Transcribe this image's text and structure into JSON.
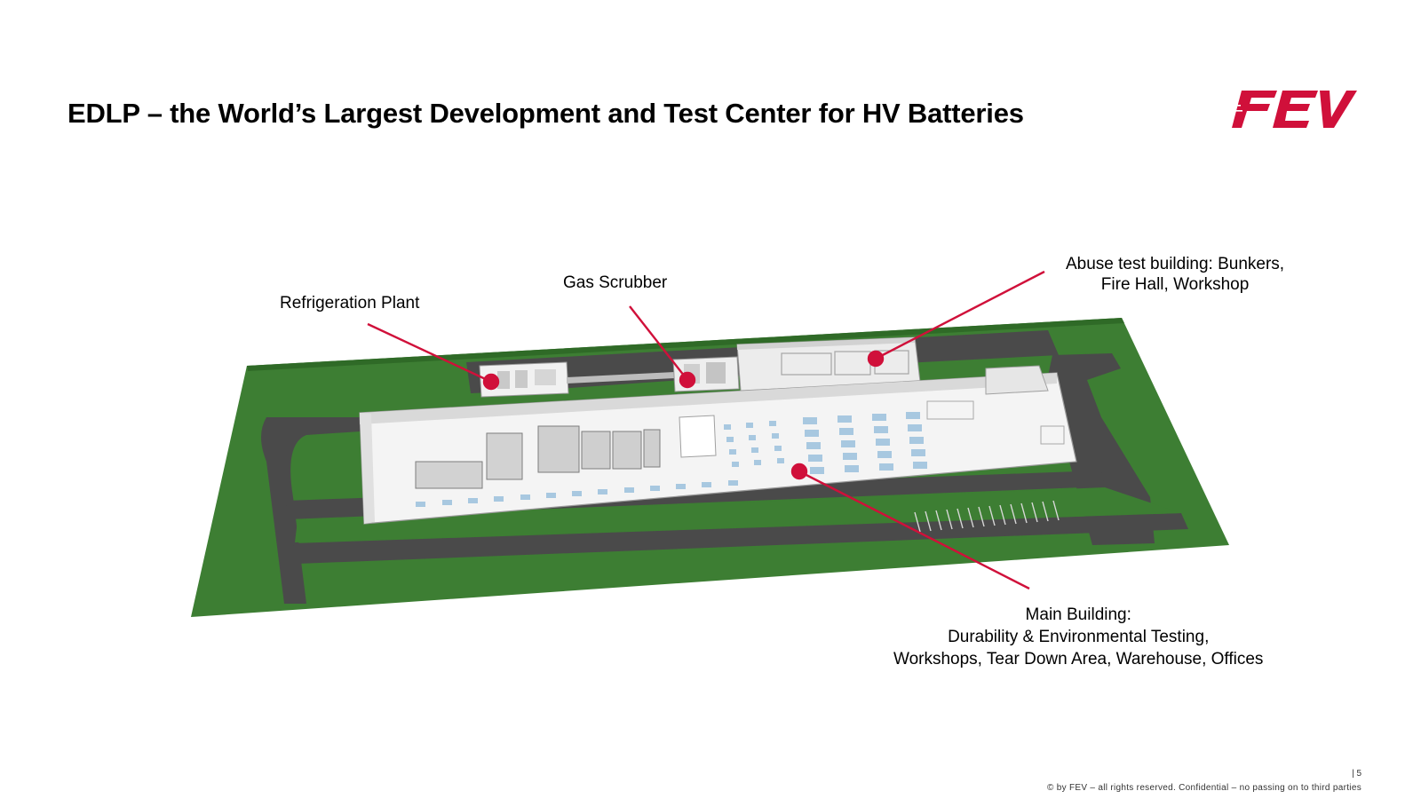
{
  "slide": {
    "title": "EDLP – the World’s Largest Development and Test Center for HV Batteries",
    "logo_text": "FEV",
    "page_number": "| 5",
    "footer": "© by FEV – all rights reserved. Confidential – no passing on to third parties"
  },
  "callouts": {
    "refrigeration": {
      "line1": "Refrigeration Plant"
    },
    "gas_scrubber": {
      "line1": "Gas Scrubber"
    },
    "abuse": {
      "line1": "Abuse test building: Bunkers,",
      "line2": "Fire Hall, Workshop"
    },
    "main": {
      "line1": "Main Building:",
      "line2": "Durability & Environmental Testing,",
      "line3": "Workshops, Tear Down Area, Warehouse, Offices"
    }
  },
  "colors": {
    "accent": "#d0103a",
    "grass": "#3d7e33",
    "road": "#4a4a4a",
    "building": "#e8e8e8",
    "equipment": "#a8c8e0"
  }
}
